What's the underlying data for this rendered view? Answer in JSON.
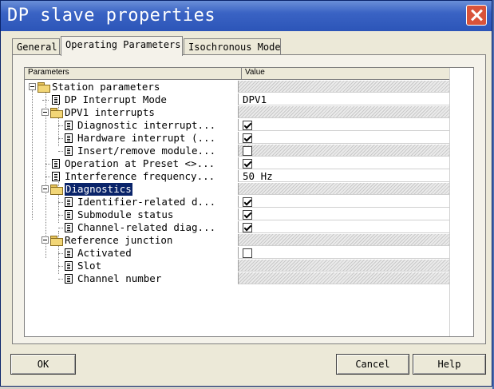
{
  "window": {
    "title": "DP slave properties"
  },
  "tabs": [
    {
      "label": "General"
    },
    {
      "label": "Operating Parameters"
    },
    {
      "label": "Isochronous Mode"
    }
  ],
  "table": {
    "col_parameters": "Parameters",
    "col_value": "Value"
  },
  "rows": [
    {
      "label": "Station parameters",
      "value": ""
    },
    {
      "label": "DP Interrupt Mode",
      "value": "DPV1"
    },
    {
      "label": "DPV1 interrupts",
      "value": ""
    },
    {
      "label": "Diagnostic interrupt...",
      "value": ""
    },
    {
      "label": "Hardware interrupt (...",
      "value": ""
    },
    {
      "label": "Insert/remove module...",
      "value": ""
    },
    {
      "label": "Operation at Preset <>...",
      "value": ""
    },
    {
      "label": "Interference frequency...",
      "value": "50 Hz"
    },
    {
      "label": "Diagnostics",
      "value": ""
    },
    {
      "label": "Identifier-related d...",
      "value": ""
    },
    {
      "label": "Submodule status",
      "value": ""
    },
    {
      "label": "Channel-related diag...",
      "value": ""
    },
    {
      "label": "Reference junction",
      "value": ""
    },
    {
      "label": "Activated",
      "value": ""
    },
    {
      "label": "Slot",
      "value": ""
    },
    {
      "label": "Channel number",
      "value": ""
    }
  ],
  "checkbox_states": {
    "diagnostic_interrupt": true,
    "hardware_interrupt": true,
    "insert_remove_module": false,
    "operation_at_preset": true,
    "identifier_related": true,
    "submodule_status": true,
    "channel_related": true,
    "activated": false
  },
  "buttons": {
    "ok": "OK",
    "cancel": "Cancel",
    "help": "Help"
  },
  "colors": {
    "title_bar": "#2c55b8",
    "selection": "#0a246a",
    "dialog_bg": "#ece9d8"
  },
  "icons": [
    "close-icon",
    "folder-icon",
    "document-icon",
    "checkbox-icon",
    "collapse-icon"
  ]
}
